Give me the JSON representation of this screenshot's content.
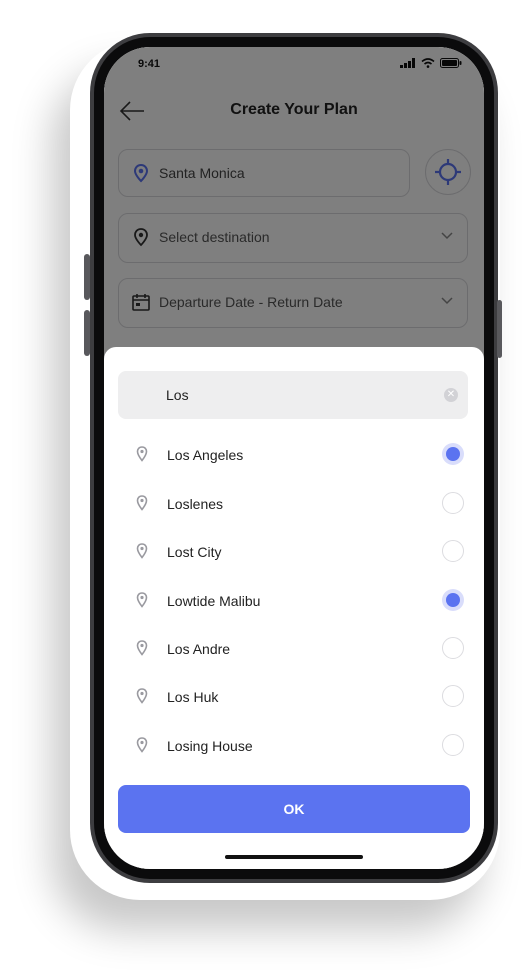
{
  "status_bar": {
    "time": "9:41"
  },
  "header": {
    "title": "Create Your Plan"
  },
  "form": {
    "origin": "Santa Monica",
    "destination_placeholder": "Select destination",
    "dates_placeholder": "Departure Date - Return Date"
  },
  "search": {
    "query": "Los"
  },
  "results": [
    {
      "label": "Los Angeles",
      "selected": true
    },
    {
      "label": "Loslenes",
      "selected": false
    },
    {
      "label": "Lost City",
      "selected": false
    },
    {
      "label": "Lowtide Malibu",
      "selected": true
    },
    {
      "label": "Los Andre",
      "selected": false
    },
    {
      "label": "Los Huk",
      "selected": false
    },
    {
      "label": "Losing House",
      "selected": false
    }
  ],
  "actions": {
    "ok_label": "OK"
  },
  "colors": {
    "accent": "#5b73f0",
    "overlay": "rgba(0,0,0,0.5)"
  }
}
